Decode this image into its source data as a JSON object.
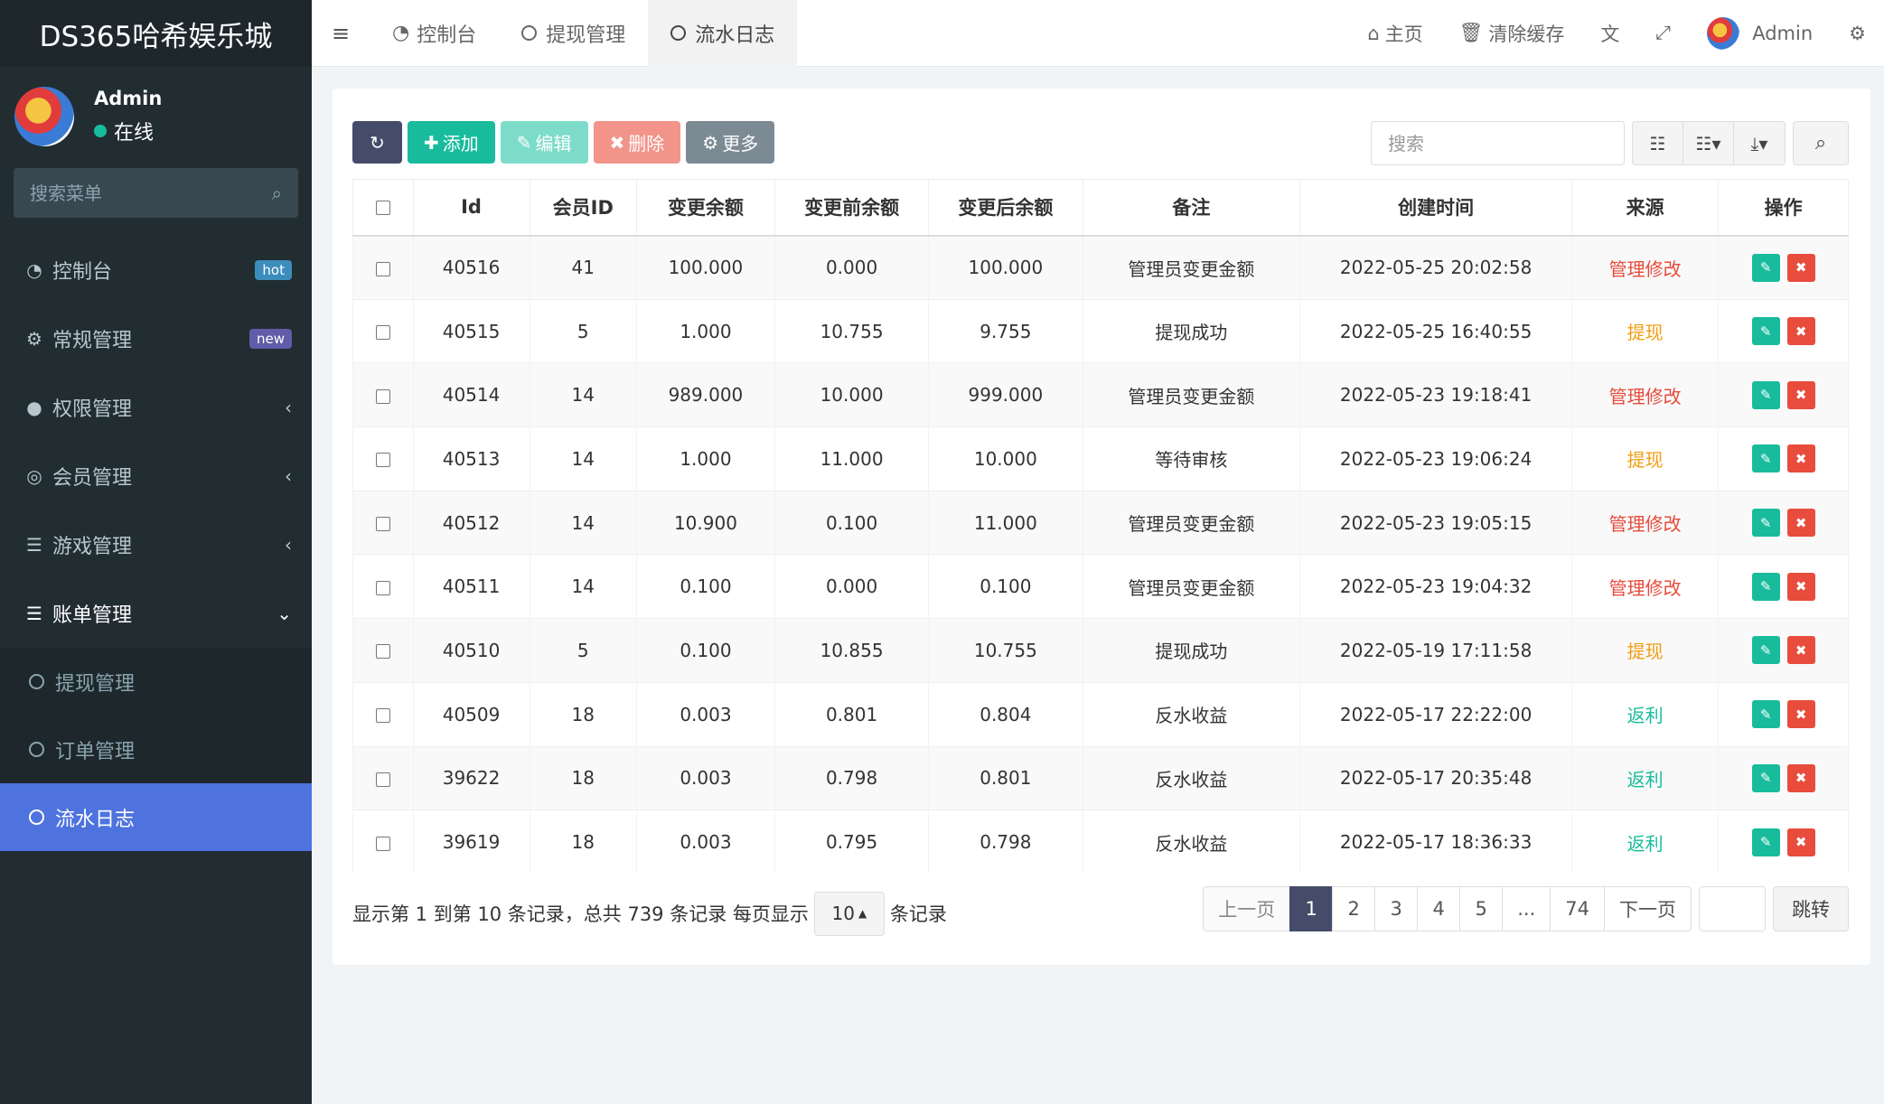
{
  "app": {
    "title": "DS365哈希娱乐城"
  },
  "user": {
    "name": "Admin",
    "status": "在线"
  },
  "sidebar": {
    "search_placeholder": "搜索菜单",
    "items": [
      {
        "label": "控制台",
        "badge": "hot",
        "icon": "dashboard-icon"
      },
      {
        "label": "常规管理",
        "badge": "new",
        "icon": "gears-icon"
      },
      {
        "label": "权限管理",
        "icon": "users-icon"
      },
      {
        "label": "会员管理",
        "icon": "user-circle-icon"
      },
      {
        "label": "游戏管理",
        "icon": "list-icon"
      },
      {
        "label": "账单管理",
        "icon": "list-icon"
      }
    ],
    "sub_items": [
      {
        "label": "提现管理"
      },
      {
        "label": "订单管理"
      },
      {
        "label": "流水日志"
      }
    ]
  },
  "header": {
    "tabs": [
      {
        "label": "控制台"
      },
      {
        "label": "提现管理"
      },
      {
        "label": "流水日志"
      }
    ],
    "home": "主页",
    "clear_cache": "清除缓存",
    "admin": "Admin"
  },
  "toolbar": {
    "add": "添加",
    "edit": "编辑",
    "delete": "删除",
    "more": "更多",
    "search_placeholder": "搜索"
  },
  "table": {
    "columns": [
      "Id",
      "会员ID",
      "变更余额",
      "变更前余额",
      "变更后余额",
      "备注",
      "创建时间",
      "来源",
      "操作"
    ],
    "rows": [
      {
        "id": "40516",
        "member": "41",
        "change": "100.000",
        "before": "0.000",
        "after": "100.000",
        "note": "管理员变更金额",
        "time": "2022-05-25 20:02:58",
        "source": "管理修改",
        "source_color": "#e74c3c"
      },
      {
        "id": "40515",
        "member": "5",
        "change": "1.000",
        "before": "10.755",
        "after": "9.755",
        "note": "提现成功",
        "time": "2022-05-25 16:40:55",
        "source": "提现",
        "source_color": "#f39c12"
      },
      {
        "id": "40514",
        "member": "14",
        "change": "989.000",
        "before": "10.000",
        "after": "999.000",
        "note": "管理员变更金额",
        "time": "2022-05-23 19:18:41",
        "source": "管理修改",
        "source_color": "#e74c3c"
      },
      {
        "id": "40513",
        "member": "14",
        "change": "1.000",
        "before": "11.000",
        "after": "10.000",
        "note": "等待审核",
        "time": "2022-05-23 19:06:24",
        "source": "提现",
        "source_color": "#f39c12"
      },
      {
        "id": "40512",
        "member": "14",
        "change": "10.900",
        "before": "0.100",
        "after": "11.000",
        "note": "管理员变更金额",
        "time": "2022-05-23 19:05:15",
        "source": "管理修改",
        "source_color": "#e74c3c"
      },
      {
        "id": "40511",
        "member": "14",
        "change": "0.100",
        "before": "0.000",
        "after": "0.100",
        "note": "管理员变更金额",
        "time": "2022-05-23 19:04:32",
        "source": "管理修改",
        "source_color": "#e74c3c"
      },
      {
        "id": "40510",
        "member": "5",
        "change": "0.100",
        "before": "10.855",
        "after": "10.755",
        "note": "提现成功",
        "time": "2022-05-19 17:11:58",
        "source": "提现",
        "source_color": "#f39c12"
      },
      {
        "id": "40509",
        "member": "18",
        "change": "0.003",
        "before": "0.801",
        "after": "0.804",
        "note": "反水收益",
        "time": "2022-05-17 22:22:00",
        "source": "返利",
        "source_color": "#18bc9c"
      },
      {
        "id": "39622",
        "member": "18",
        "change": "0.003",
        "before": "0.798",
        "after": "0.801",
        "note": "反水收益",
        "time": "2022-05-17 20:35:48",
        "source": "返利",
        "source_color": "#18bc9c"
      },
      {
        "id": "39619",
        "member": "18",
        "change": "0.003",
        "before": "0.795",
        "after": "0.798",
        "note": "反水收益",
        "time": "2022-05-17 18:36:33",
        "source": "返利",
        "source_color": "#18bc9c"
      }
    ]
  },
  "footer": {
    "info": "显示第 1 到第 10 条记录，总共 739 条记录 每页显示",
    "page_size": "10",
    "suffix": "条记录",
    "prev": "上一页",
    "next": "下一页",
    "pages": [
      "1",
      "2",
      "3",
      "4",
      "5",
      "...",
      "74"
    ],
    "jump": "跳转"
  },
  "colors": {
    "sidebar_bg": "#222d32",
    "accent": "#4e73df",
    "primary_dark": "#444c69",
    "success": "#18bc9c",
    "danger": "#e74c3c",
    "warning": "#f39c12"
  }
}
